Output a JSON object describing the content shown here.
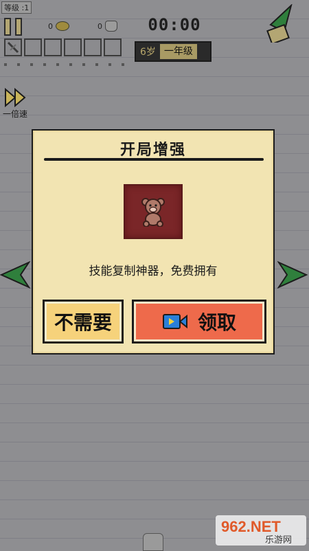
{
  "hud": {
    "level_label": "等级 :1",
    "coin_count": "0",
    "cat_count": "0",
    "timer": "00:00",
    "age": "6岁",
    "grade": "一年级",
    "speed_label": "一倍速"
  },
  "dialog": {
    "title": "开局增强",
    "item_icon": "teddy-bear-icon",
    "description": "技能复制神器，免费拥有",
    "decline_label": "不需要",
    "claim_label": "领取",
    "claim_icon": "video-camera-icon"
  },
  "watermark": {
    "brand": "962.NET",
    "subtitle": "乐游网"
  },
  "colors": {
    "dialog_bg": "#f2e4b2",
    "decline_bg": "#f6d27b",
    "claim_bg": "#ee6a4b",
    "item_tile_bg": "#7a2628",
    "arrow_green": "#2f7f3c"
  }
}
